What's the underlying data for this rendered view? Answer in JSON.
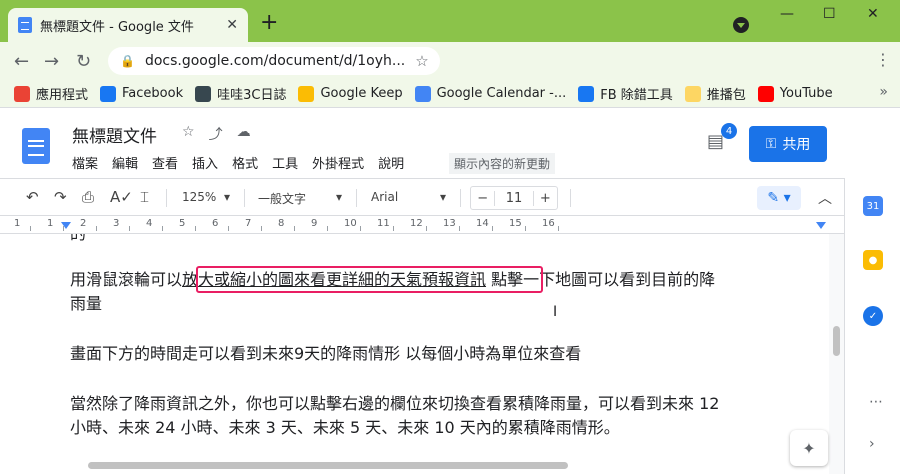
{
  "browser": {
    "tab_title": "無標題文件 - Google 文件",
    "tab_close": "✕",
    "new_tab": "+",
    "window": {
      "minimize": "—",
      "maximize": "☐",
      "close": "✕"
    },
    "url": "docs.google.com/document/d/1oyh...",
    "nav": {
      "back": "←",
      "forward": "→",
      "reload": "↻"
    },
    "bookmarks": [
      {
        "label": "應用程式",
        "icon": "apps-icon",
        "color": "#ea4335"
      },
      {
        "label": "Facebook",
        "icon": "facebook-icon",
        "color": "#1877f2"
      },
      {
        "label": "哇哇3C日誌",
        "icon": "monitor-icon",
        "color": "#37474f"
      },
      {
        "label": "Google Keep",
        "icon": "keep-icon",
        "color": "#fbbc04"
      },
      {
        "label": "Google Calendar -...",
        "icon": "calendar-icon",
        "color": "#4285f4"
      },
      {
        "label": "FB 除錯工具",
        "icon": "facebook-icon",
        "color": "#1877f2"
      },
      {
        "label": "推播包",
        "icon": "folder-icon",
        "color": "#fdd663"
      },
      {
        "label": "YouTube",
        "icon": "youtube-icon",
        "color": "#ff0000"
      }
    ],
    "bookmarks_more": "»"
  },
  "docs": {
    "title": "無標題文件",
    "menu": [
      "檔案",
      "編輯",
      "查看",
      "插入",
      "格式",
      "工具",
      "外掛程式",
      "說明"
    ],
    "last_edit": "顯示內容的新更動",
    "comments_badge": "4",
    "share_label": "共用",
    "toolbar": {
      "zoom": "125%",
      "style": "一般文字",
      "font": "Arial",
      "font_size": "11",
      "minus": "−",
      "plus": "+"
    },
    "ruler_numbers": [
      "1",
      "1",
      "2",
      "3",
      "4",
      "5",
      "6",
      "7",
      "8",
      "9",
      "10",
      "11",
      "12",
      "13",
      "14",
      "15",
      "16"
    ]
  },
  "content": {
    "fragment_top": "的",
    "para1_before": "用滑鼠滾輪可以",
    "para1_highlight": "放大或縮小的圖來看更詳細的天氣預報資訊",
    "para1_after": " 點擊一下地圖可以看到目前的降",
    "para1_line2": "雨量",
    "para2": "畫面下方的時間走可以看到未來9天的降雨情形 以每個小時為單位來查看",
    "para3_line1": "當然除了降雨資訊之外，你也可以點擊右邊的欄位來切換查看累積降雨量，可以看到未來 12",
    "para3_line2": "小時、未來 24 小時、未來 3 天、未來 5 天、未來 10 天內的累積降雨情形。"
  },
  "colors": {
    "chrome": "#8bc34a",
    "accent": "#1a73e8",
    "highlight_box": "#e91e63"
  }
}
